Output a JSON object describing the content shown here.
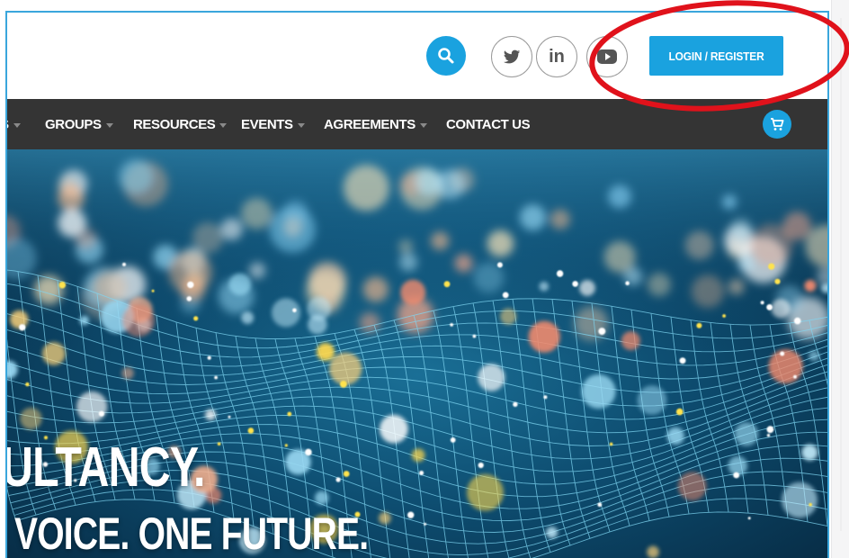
{
  "header": {
    "login_label": "LOGIN / REGISTER",
    "social": {
      "twitter": "twitter-icon",
      "linkedin": "in",
      "youtube": "youtube-icon"
    }
  },
  "nav": {
    "items": [
      {
        "label": "S",
        "has_caret": true
      },
      {
        "label": "GROUPS",
        "has_caret": true
      },
      {
        "label": "RESOURCES",
        "has_caret": true
      },
      {
        "label": "EVENTS",
        "has_caret": true
      },
      {
        "label": "AGREEMENTS",
        "has_caret": true
      },
      {
        "label": "CONTACT US",
        "has_caret": false
      }
    ]
  },
  "hero": {
    "line1": "ULTANCY.",
    "line2": "VOICE. ONE FUTURE."
  },
  "colors": {
    "accent": "#1aa2df",
    "nav_bg": "#343434",
    "annotation": "#e0121b",
    "frame": "#3aa6dc"
  }
}
